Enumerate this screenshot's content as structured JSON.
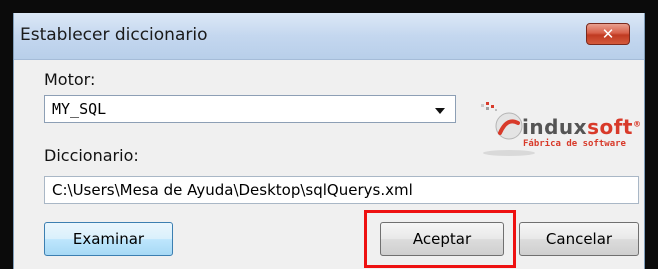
{
  "window": {
    "title": "Establecer diccionario"
  },
  "form": {
    "motor_label": "Motor:",
    "motor_value": "MY_SQL",
    "diccionario_label": "Diccionario:",
    "diccionario_value": "C:\\Users\\Mesa de Ayuda\\Desktop\\sqlQuerys.xml"
  },
  "buttons": {
    "examinar": "Examinar",
    "aceptar": "Aceptar",
    "cancelar": "Cancelar"
  },
  "logo": {
    "brand_main": "indux",
    "brand_accent": "soft",
    "registered": "®",
    "tagline": "Fábrica de software"
  },
  "colors": {
    "highlight": "#ee1111",
    "brand_red": "#d83a2a"
  }
}
